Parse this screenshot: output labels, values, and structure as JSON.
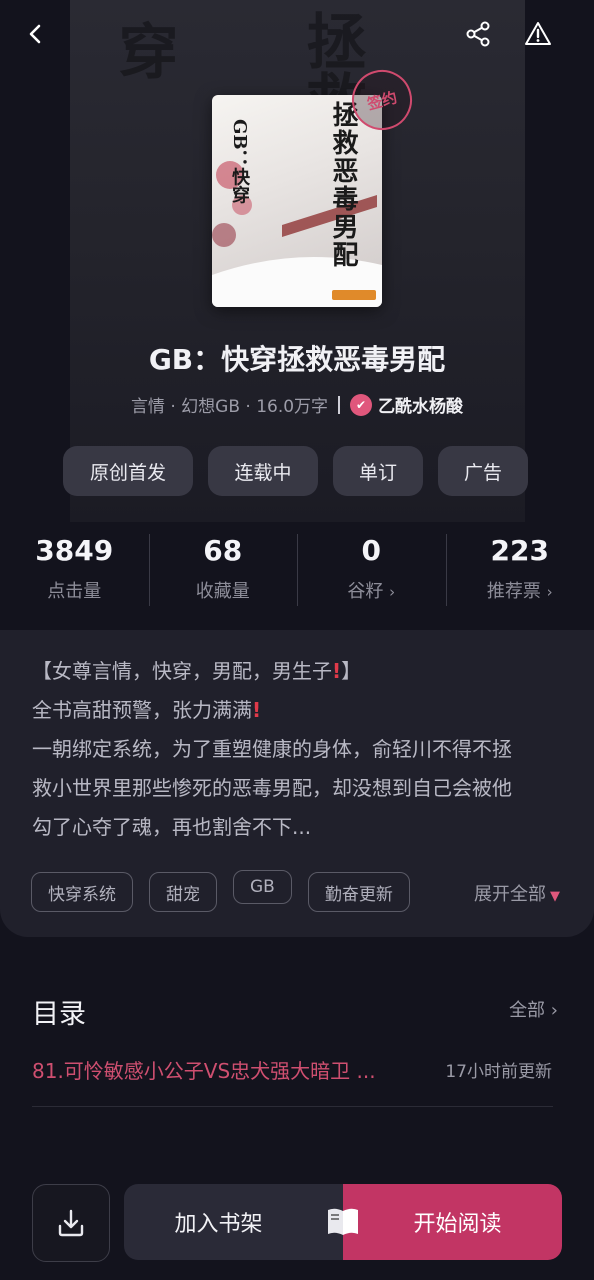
{
  "book": {
    "title": "GB：快穿拯救恶毒男配",
    "cover_title": "拯救恶毒男配",
    "cover_subtitle": "GB：快穿",
    "stamp_text": "签约",
    "meta": "言情 · 幻想GB · 16.0万字",
    "author": "乙酰水杨酸"
  },
  "tags": [
    {
      "label": "原创首发"
    },
    {
      "label": "连载中"
    },
    {
      "label": "单订"
    },
    {
      "label": "广告"
    }
  ],
  "stats": [
    {
      "value": "3849",
      "label": "点击量",
      "has_arrow": false
    },
    {
      "value": "68",
      "label": "收藏量",
      "has_arrow": false
    },
    {
      "value": "0",
      "label": "谷籽",
      "has_arrow": true
    },
    {
      "value": "223",
      "label": "推荐票",
      "has_arrow": true
    }
  ],
  "description": {
    "line1": "【女尊言情，快穿，男配，男生子",
    "line1_end": "】",
    "line2": "全书高甜预警，张力满满",
    "line3": "一朝绑定系统，为了重塑健康的身体，俞轻川不得不拯",
    "line4": "救小世界里那些惨死的恶毒男配，却没想到自己会被他",
    "line5": "勾了心夺了魂，再也割舍不下..."
  },
  "genre_tags": [
    "快穿系统",
    "甜宠",
    "GB",
    "勤奋更新"
  ],
  "expand_label": "展开全部",
  "toc": {
    "title": "目录",
    "all_label": "全部",
    "latest_chapter": "81.可怜敏感小公子VS忠犬强大暗卫 ...",
    "updated": "17小时前更新"
  },
  "actions": {
    "add_shelf": "加入书架",
    "start_reading": "开始阅读"
  },
  "colors": {
    "accent": "#c23564",
    "background": "#13131d"
  }
}
